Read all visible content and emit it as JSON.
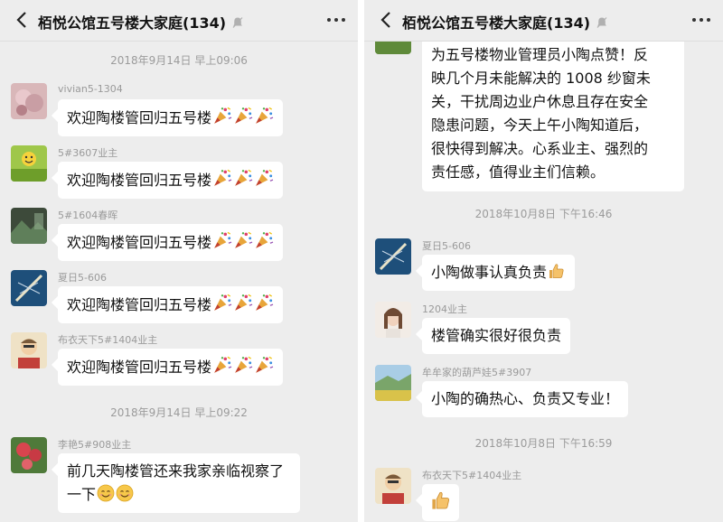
{
  "left": {
    "header": {
      "title": "栢悦公馆五号楼大家庭(134)"
    },
    "timestamp_1": "2018年9月14日 早上09:06",
    "messages": [
      {
        "sender": "vivian5-1304",
        "text": "欢迎陶楼管回归五号楼",
        "emoji": "party-popper",
        "avatar": "pink-flowers"
      },
      {
        "sender": "5#3607业主",
        "text": "欢迎陶楼管回归五号楼",
        "emoji": "party-popper",
        "avatar": "smiley-on-grass"
      },
      {
        "sender": "5#1604春晖",
        "text": "欢迎陶楼管回归五号楼",
        "emoji": "party-popper",
        "avatar": "dark-landscape"
      },
      {
        "sender": "夏日5-606",
        "text": "欢迎陶楼管回归五号楼",
        "emoji": "party-popper",
        "avatar": "rowing-boat"
      },
      {
        "sender": "布衣天下5#1404业主",
        "text": "欢迎陶楼管回归五号楼",
        "emoji": "party-popper",
        "avatar": "cartoon-man"
      }
    ],
    "timestamp_2": "2018年9月14日 早上09:22",
    "last_message": {
      "sender": "李艳5#908业主",
      "line1": "前几天陶楼管还来我家亲临视察了",
      "line2": "一下",
      "emoji": "smile",
      "avatar": "red-flowers"
    }
  },
  "right": {
    "header": {
      "title": "栢悦公馆五号楼大家庭(134)"
    },
    "top_message": {
      "lines": [
        "为五号楼物业管理员小陶点赞！反",
        "映几个月未能解决的 1008 纱窗未",
        "关，干扰周边业户休息且存在安全",
        "隐患问题，今天上午小陶知道后，",
        "很快得到解决。心系业主、强烈的",
        "责任感，值得业主们信赖。"
      ]
    },
    "timestamp_1": "2018年10月8日 下午16:46",
    "messages": [
      {
        "sender": "夏日5-606",
        "text": "小陶做事认真负责",
        "emoji": "thumbs-up",
        "avatar": "rowing-boat"
      },
      {
        "sender": "1204业主",
        "text": "楼管确实很好很负责",
        "emoji": "",
        "avatar": "woman-portrait"
      },
      {
        "sender": "牟牟家的葫芦娃5#3907",
        "text": "小陶的确热心、负责又专业！",
        "emoji": "",
        "avatar": "field-landscape"
      }
    ],
    "timestamp_2": "2018年10月8日 下午16:59",
    "last_message": {
      "sender": "布衣天下5#1404业主",
      "emoji": "thumbs-up",
      "avatar": "cartoon-man"
    }
  }
}
